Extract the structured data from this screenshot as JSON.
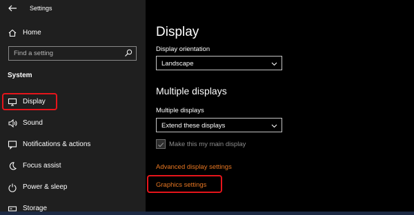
{
  "window": {
    "title": "Settings"
  },
  "sidebar": {
    "home_label": "Home",
    "search": {
      "placeholder": "Find a setting"
    },
    "section_label": "System",
    "items": [
      {
        "label": "Display",
        "icon": "monitor-icon",
        "selected": true
      },
      {
        "label": "Sound",
        "icon": "speaker-icon"
      },
      {
        "label": "Notifications & actions",
        "icon": "notifications-icon"
      },
      {
        "label": "Focus assist",
        "icon": "moon-icon"
      },
      {
        "label": "Power & sleep",
        "icon": "power-icon"
      },
      {
        "label": "Storage",
        "icon": "storage-icon"
      }
    ]
  },
  "main": {
    "title": "Display",
    "orientation": {
      "label": "Display orientation",
      "value": "Landscape"
    },
    "multiple_displays_heading": "Multiple displays",
    "multiple_displays": {
      "label": "Multiple displays",
      "value": "Extend these displays"
    },
    "main_display_checkbox": {
      "label": "Make this my main display",
      "checked": true,
      "disabled": true
    },
    "links": {
      "advanced": "Advanced display settings",
      "graphics": "Graphics settings"
    }
  },
  "colors": {
    "sidebar_bg": "#1f1f1f",
    "main_bg": "#000000",
    "link": "#e87722",
    "highlight": "#e8151b"
  }
}
